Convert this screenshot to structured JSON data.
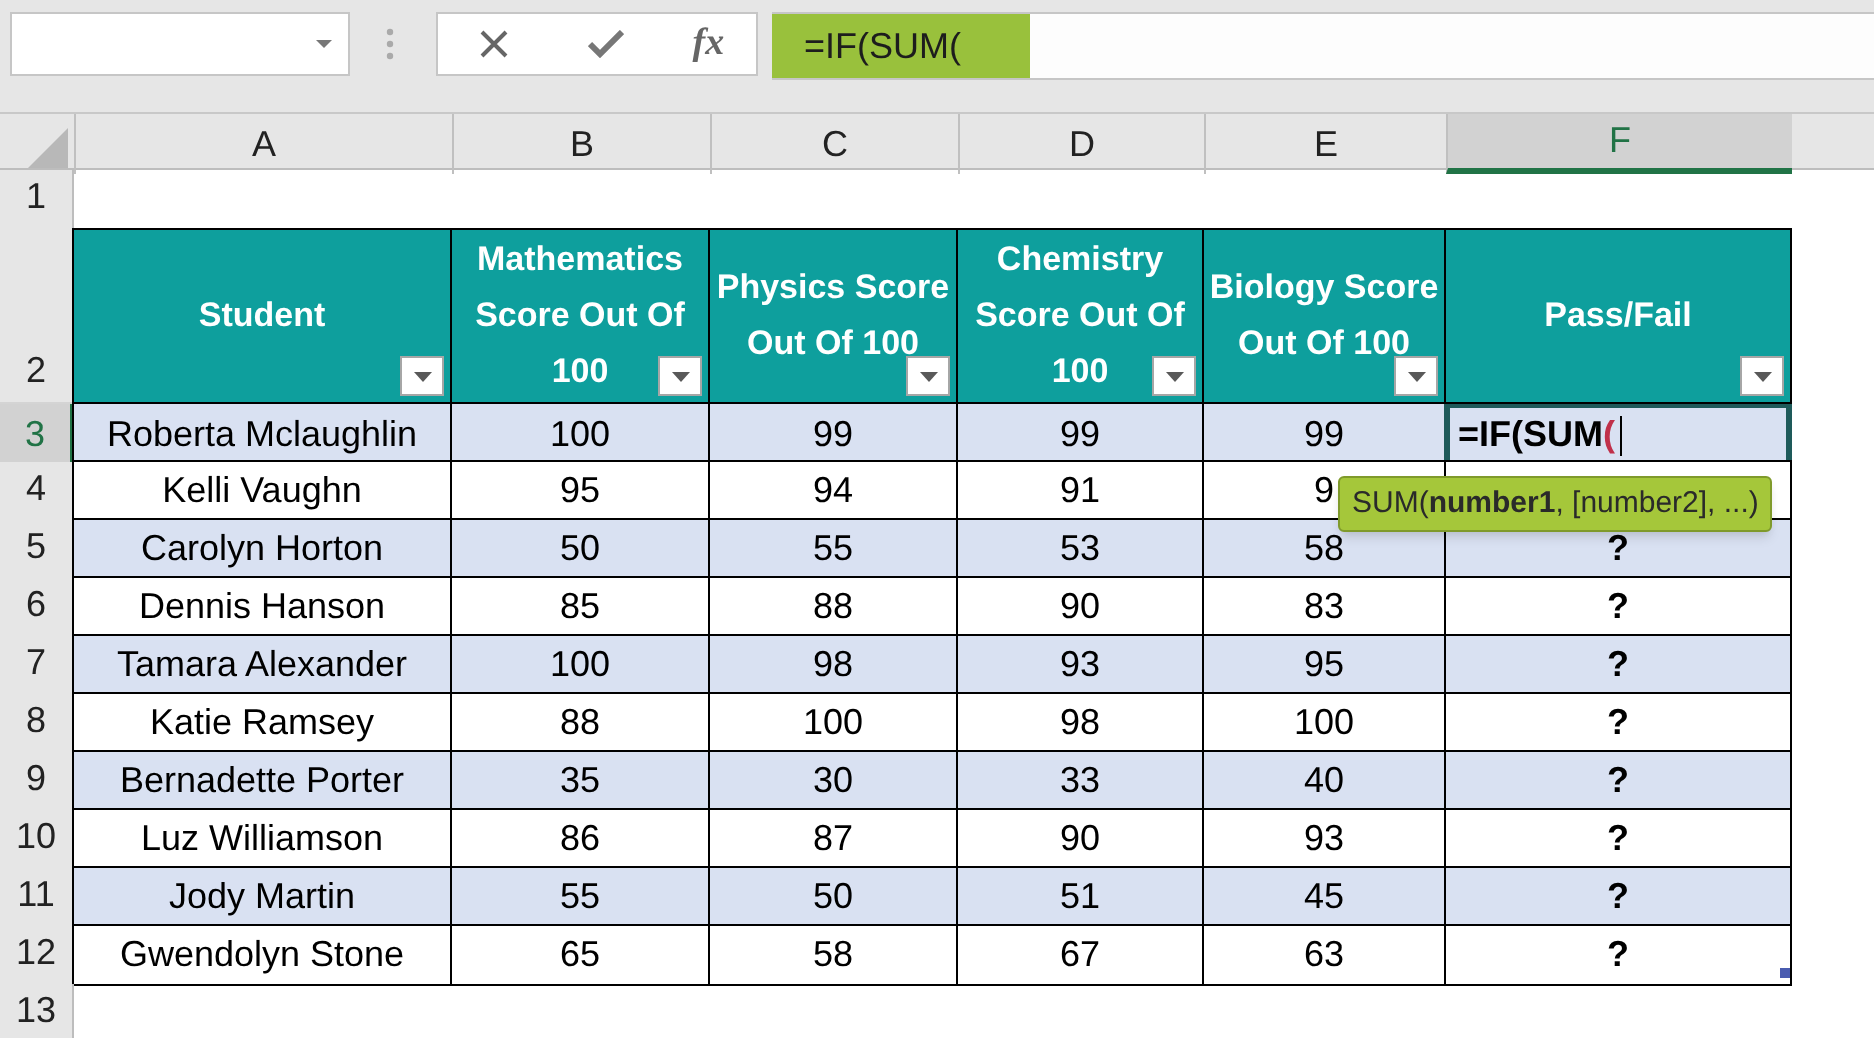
{
  "formula_bar": {
    "fx": "fx",
    "formula": "=IF(SUM("
  },
  "columns": [
    {
      "label": "A",
      "selected": false
    },
    {
      "label": "B",
      "selected": false
    },
    {
      "label": "C",
      "selected": false
    },
    {
      "label": "D",
      "selected": false
    },
    {
      "label": "E",
      "selected": false
    },
    {
      "label": "F",
      "selected": true
    }
  ],
  "row_headers": [
    {
      "label": "1",
      "selected": false
    },
    {
      "label": "2",
      "selected": false
    },
    {
      "label": "3",
      "selected": true
    },
    {
      "label": "4",
      "selected": false
    },
    {
      "label": "5",
      "selected": false
    },
    {
      "label": "6",
      "selected": false
    },
    {
      "label": "7",
      "selected": false
    },
    {
      "label": "8",
      "selected": false
    },
    {
      "label": "9",
      "selected": false
    },
    {
      "label": "10",
      "selected": false
    },
    {
      "label": "11",
      "selected": false
    },
    {
      "label": "12",
      "selected": false
    },
    {
      "label": "13",
      "selected": false
    }
  ],
  "table": {
    "headers": [
      "Student",
      "Mathematics Score Out Of 100",
      "Physics Score Out Of 100",
      "Chemistry Score Out Of 100",
      "Biology Score Out Of 100",
      "Pass/Fail"
    ],
    "rows": [
      {
        "cells": [
          "Roberta Mclaughlin",
          "100",
          "99",
          "99",
          "99"
        ],
        "edit": {
          "text": "=IF(SUM",
          "paren": "("
        }
      },
      {
        "cells": [
          "Kelli Vaughn",
          "95",
          "94",
          "91",
          "9"
        ]
      },
      {
        "cells": [
          "Carolyn Horton",
          "50",
          "55",
          "53",
          "58",
          "?"
        ]
      },
      {
        "cells": [
          "Dennis Hanson",
          "85",
          "88",
          "90",
          "83",
          "?"
        ]
      },
      {
        "cells": [
          "Tamara Alexander",
          "100",
          "98",
          "93",
          "95",
          "?"
        ]
      },
      {
        "cells": [
          "Katie Ramsey",
          "88",
          "100",
          "98",
          "100",
          "?"
        ]
      },
      {
        "cells": [
          "Bernadette Porter",
          "35",
          "30",
          "33",
          "40",
          "?"
        ]
      },
      {
        "cells": [
          "Luz Williamson",
          "86",
          "87",
          "90",
          "93",
          "?"
        ]
      },
      {
        "cells": [
          "Jody Martin",
          "55",
          "50",
          "51",
          "45",
          "?"
        ]
      },
      {
        "cells": [
          "Gwendolyn Stone",
          "65",
          "58",
          "67",
          "63",
          "?"
        ]
      }
    ]
  },
  "tooltip": "SUM(**number1**, [number2], ...)"
}
